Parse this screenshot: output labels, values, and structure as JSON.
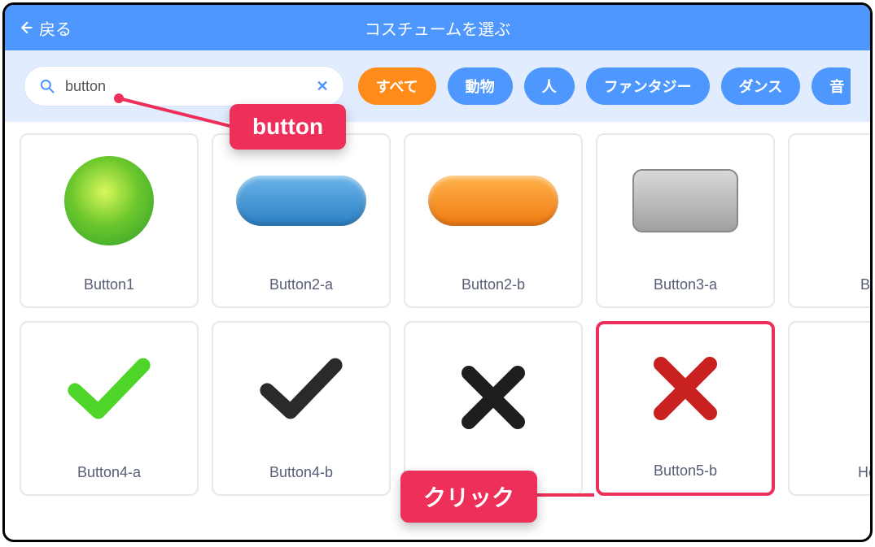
{
  "header": {
    "back_label": "戻る",
    "title": "コスチュームを選ぶ"
  },
  "search": {
    "value": "button"
  },
  "categories": [
    {
      "label": "すべて",
      "active": true
    },
    {
      "label": "動物",
      "active": false
    },
    {
      "label": "人",
      "active": false
    },
    {
      "label": "ファンタジー",
      "active": false
    },
    {
      "label": "ダンス",
      "active": false
    },
    {
      "label": "音",
      "active": false
    }
  ],
  "items": [
    {
      "label": "Button1",
      "thumb": "button1",
      "selected": false
    },
    {
      "label": "Button2-a",
      "thumb": "capblue",
      "selected": false
    },
    {
      "label": "Button2-b",
      "thumb": "caporange",
      "selected": false
    },
    {
      "label": "Button3-a",
      "thumb": "rectgray",
      "selected": false
    },
    {
      "label": "Butto",
      "thumb": "rectblue",
      "selected": false
    },
    {
      "label": "Button4-a",
      "thumb": "checkgreen",
      "selected": false
    },
    {
      "label": "Button4-b",
      "thumb": "checkblack",
      "selected": false
    },
    {
      "label": "",
      "thumb": "xblack",
      "selected": false
    },
    {
      "label": "Button5-b",
      "thumb": "xred",
      "selected": true
    },
    {
      "label": "Home",
      "thumb": "home",
      "selected": false
    }
  ],
  "callouts": {
    "search_annot": "button",
    "click_annot": "クリック"
  }
}
